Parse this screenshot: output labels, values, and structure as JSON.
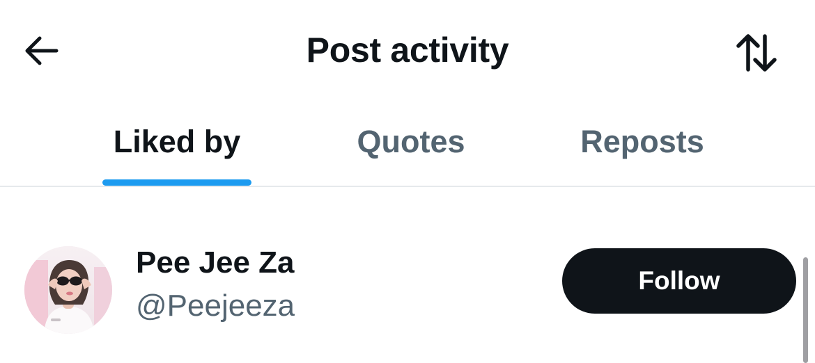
{
  "header": {
    "title": "Post activity",
    "back_icon": "arrow-left-icon",
    "sort_icon": "sort-arrows-icon"
  },
  "tabs": [
    {
      "label": "Liked by",
      "active": true
    },
    {
      "label": "Quotes",
      "active": false
    },
    {
      "label": "Reposts",
      "active": false
    }
  ],
  "users": [
    {
      "display_name": "Pee Jee Za",
      "handle": "@Peejeeza",
      "follow_label": "Follow"
    }
  ],
  "colors": {
    "text_primary": "#0f1419",
    "text_secondary": "#536471",
    "accent": "#1d9bf0",
    "button_bg": "#0f1419",
    "divider": "#e6e9ec"
  }
}
